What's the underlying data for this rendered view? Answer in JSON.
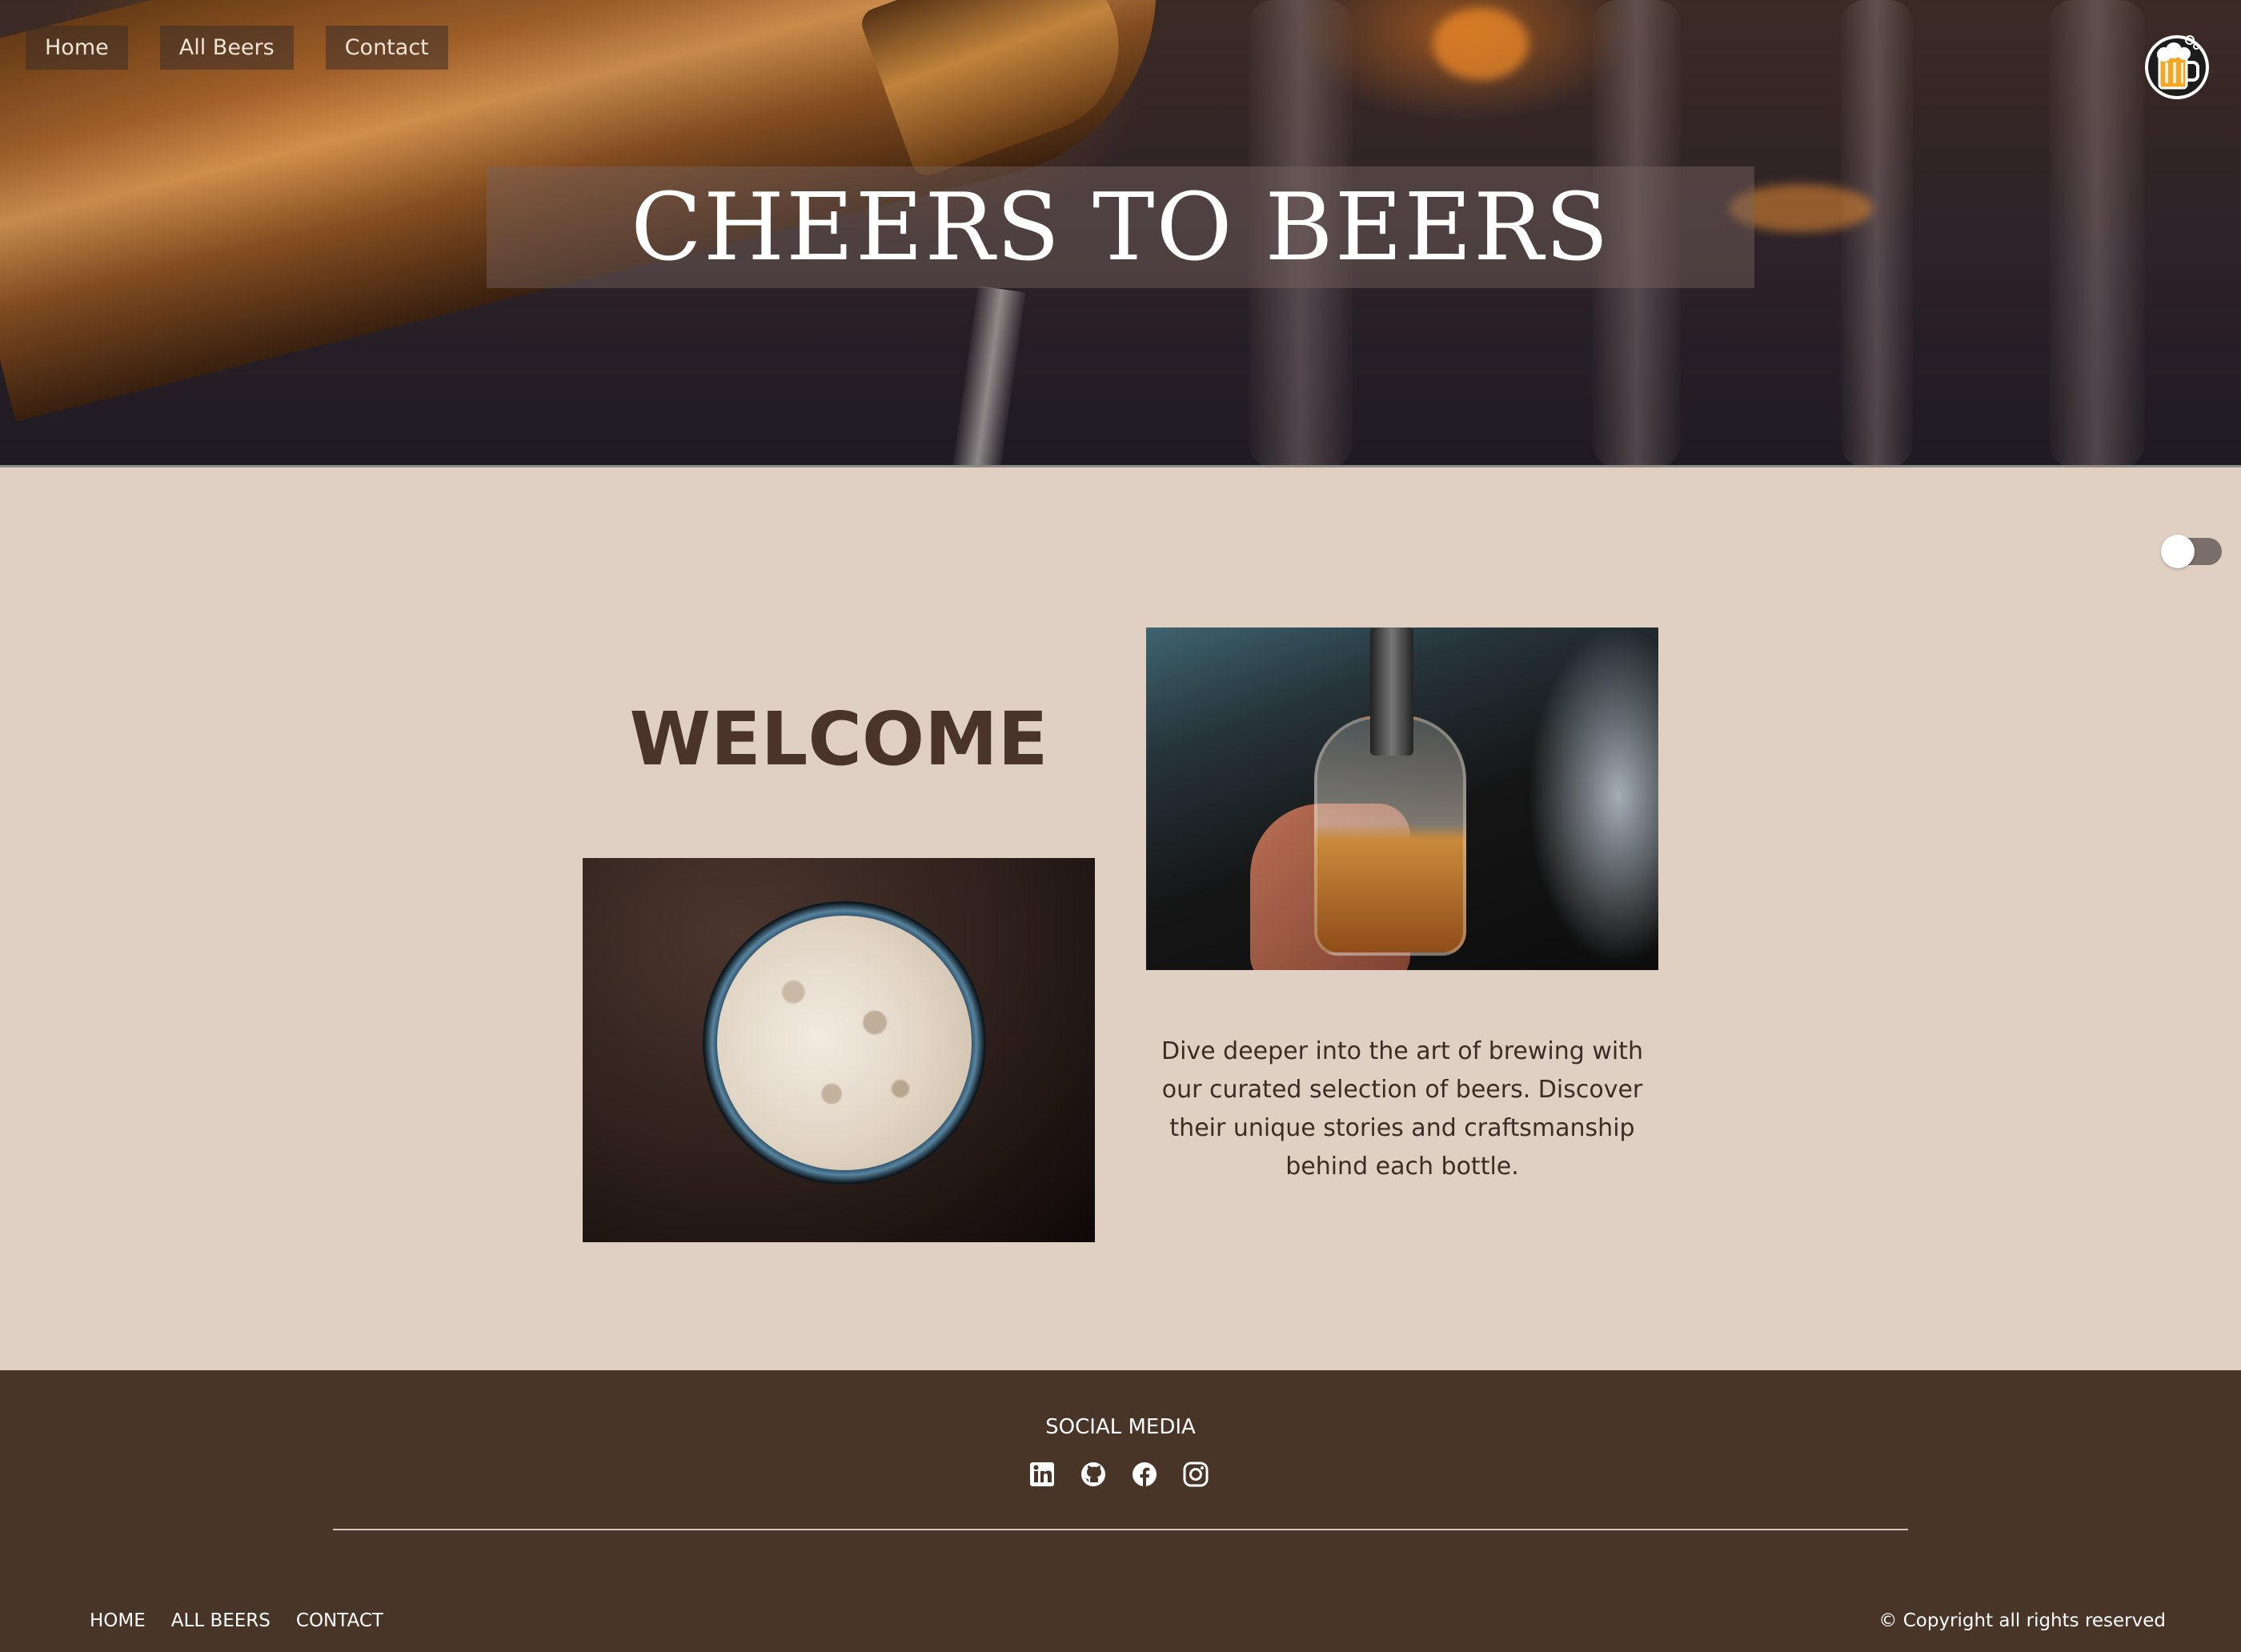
{
  "nav": {
    "items": [
      {
        "label": "Home"
      },
      {
        "label": "All Beers"
      },
      {
        "label": "Contact"
      }
    ]
  },
  "hero": {
    "title": "CHEERS TO BEERS",
    "logo_icon": "beer-mug-icon"
  },
  "theme_toggle": {
    "icon": "toggle-switch",
    "state": "off"
  },
  "main": {
    "welcome": "WELCOME",
    "description": "Dive deeper into the art of brewing with our curated selection of beers. Discover their unique stories and craftsmanship behind each bottle."
  },
  "footer": {
    "social_title": "SOCIAL MEDIA",
    "social_icons": [
      "linkedin-icon",
      "github-icon",
      "facebook-icon",
      "instagram-icon"
    ],
    "nav": [
      {
        "label": "HOME"
      },
      {
        "label": "ALL BEERS"
      },
      {
        "label": "CONTACT"
      }
    ],
    "copyright": "© Copyright all rights reserved"
  },
  "colors": {
    "page_bg": "#e0d0c3",
    "footer_bg": "#493428",
    "heading": "#4a3328",
    "text": "#3b2c26"
  }
}
